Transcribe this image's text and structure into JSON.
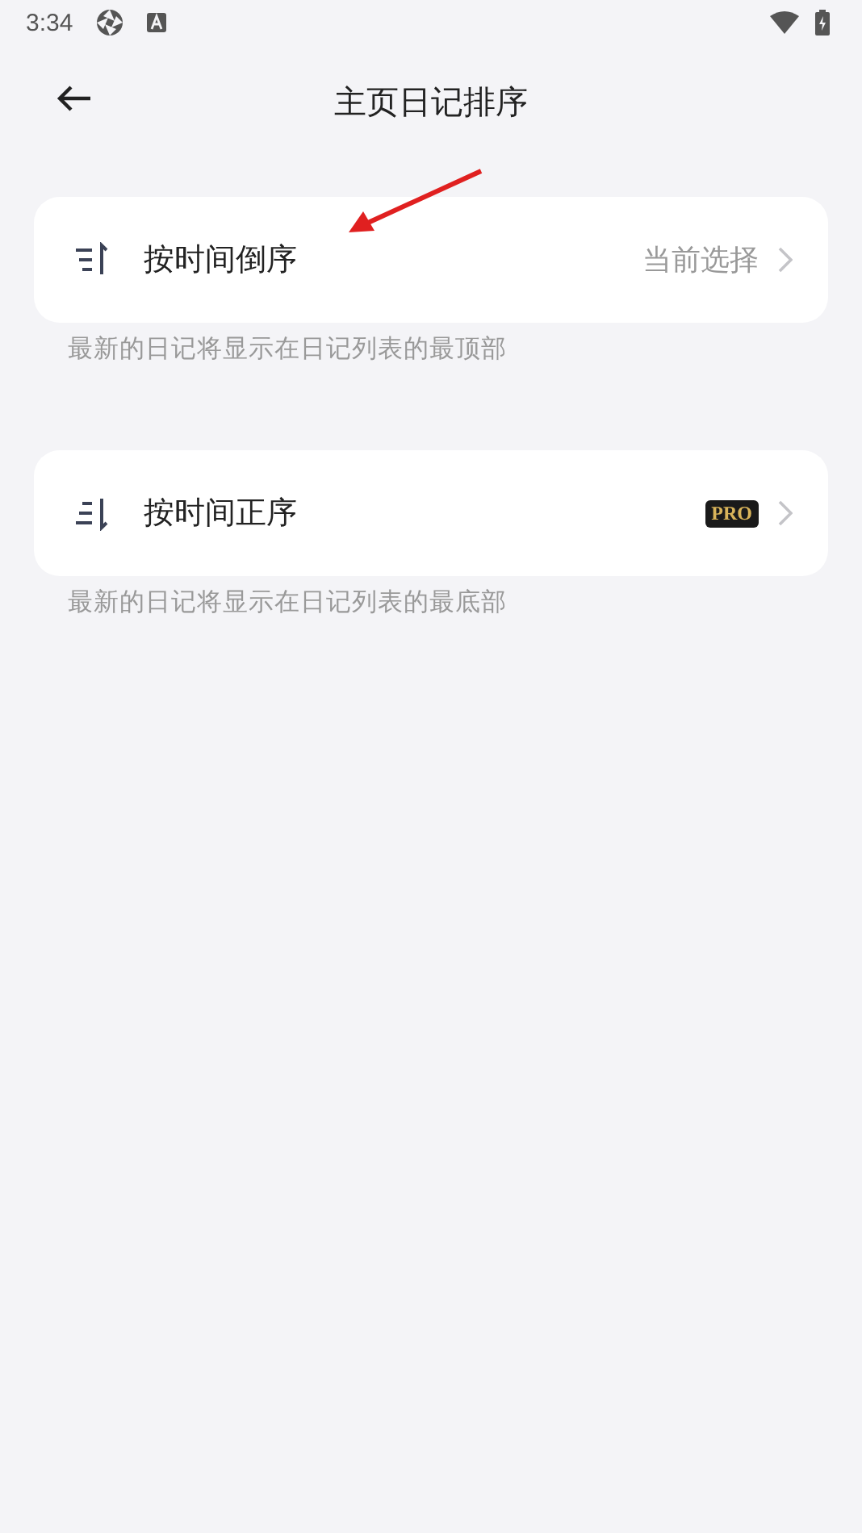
{
  "status_bar": {
    "time": "3:34"
  },
  "header": {
    "title": "主页日记排序"
  },
  "options": [
    {
      "kind": "desc",
      "label": "按时间倒序",
      "trailing": "当前选择",
      "description": "最新的日记将显示在日记列表的最顶部"
    },
    {
      "kind": "asc",
      "label": "按时间正序",
      "badge": "PRO",
      "description": "最新的日记将显示在日记列表的最底部"
    }
  ]
}
